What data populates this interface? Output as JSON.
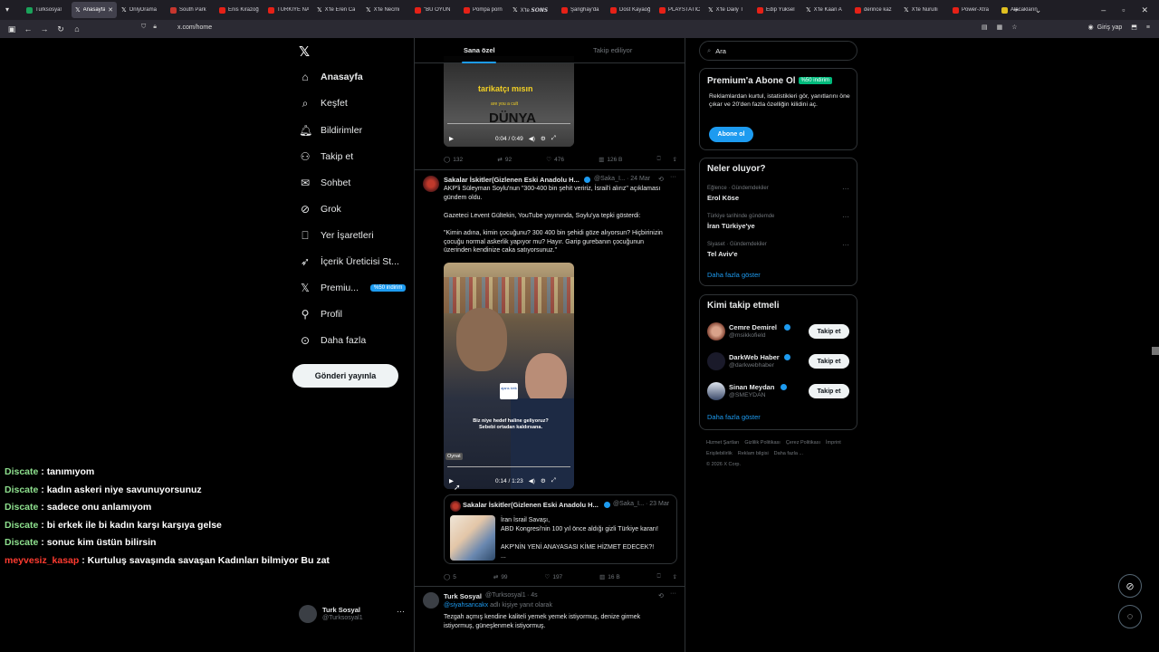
{
  "browser": {
    "tabs": [
      {
        "label": "Turksosyal",
        "fav": "g"
      },
      {
        "label": "Anasayfa",
        "fav": "x",
        "active": true
      },
      {
        "label": "OnlyDrama",
        "fav": "x"
      },
      {
        "label": "South Park",
        "fav": "sp"
      },
      {
        "label": "Enis Kirazoğ",
        "fav": "yt"
      },
      {
        "label": "TÜRKİYE NA",
        "fav": "yt"
      },
      {
        "label": "X'te Eren Ca",
        "fav": "x"
      },
      {
        "label": "X'te Necmi",
        "fav": "x"
      },
      {
        "label": "\"BU OYUN",
        "fav": "yt"
      },
      {
        "label": "Pompa porn",
        "fav": "yt"
      },
      {
        "label": "X'te 𝙎𝙊𝙉𝙎",
        "fav": "x"
      },
      {
        "label": "Şanghay'da",
        "fav": "yt"
      },
      {
        "label": "Dost Kayaoğ",
        "fav": "yt"
      },
      {
        "label": "PLAYSTATIC",
        "fav": "yt"
      },
      {
        "label": "X'te Daily T",
        "fav": "x"
      },
      {
        "label": "Edip Yüksel",
        "fav": "yt"
      },
      {
        "label": "X'te Kaan A",
        "fav": "x"
      },
      {
        "label": "derince kaz",
        "fav": "yt"
      },
      {
        "label": "X'te Nurullı",
        "fav": "x"
      },
      {
        "label": "Power-Xtra",
        "fav": "yt"
      },
      {
        "label": "Alacakların",
        "fav": "yel"
      }
    ],
    "url": "x.com/home",
    "signin_label": "Giriş yap"
  },
  "sidebar": {
    "items": [
      {
        "label": "Anasayfa",
        "icon": "home-icon"
      },
      {
        "label": "Keşfet",
        "icon": "search-icon"
      },
      {
        "label": "Bildirimler",
        "icon": "bell-icon"
      },
      {
        "label": "Takip et",
        "icon": "add-user-icon"
      },
      {
        "label": "Sohbet",
        "icon": "mail-icon"
      },
      {
        "label": "Grok",
        "icon": "grok-icon"
      },
      {
        "label": "Yer İşaretleri",
        "icon": "bookmark-icon"
      },
      {
        "label": "İçerik Üreticisi St...",
        "icon": "rocket-icon"
      },
      {
        "label": "Premiu...",
        "icon": "x-icon"
      },
      {
        "label": "Profil",
        "icon": "person-icon"
      },
      {
        "label": "Daha fazla",
        "icon": "more-circle-icon"
      }
    ],
    "premium_badge": "%50 indirim",
    "post_button": "Gönderi yayınla",
    "account": {
      "name": "Turk Sosyal",
      "handle": "@Turksosyal1"
    }
  },
  "feed": {
    "tabs": [
      "Sana özel",
      "Takip ediliyor"
    ],
    "post1": {
      "video_caption1": "tarikatçı mısın",
      "video_caption2": "are you a cult",
      "video_caption3": "DÜNYA",
      "time": "0:04 / 0:49",
      "replies": "132",
      "reposts": "92",
      "likes": "476",
      "views": "126 B"
    },
    "post2": {
      "name": "Sakalar İskitler(Gizlenen Eski Anadolu H...",
      "handle": "@Saka_I...",
      "date": "· 24 Mar",
      "text1": "AKP'li Süleyman Soylu'nun \"300-400 bin şehit veririz, İsrail'i alırız\" açıklaması gündem oldu.",
      "text2": "Gazeteci Levent Gültekin, YouTube yayınında, Soylu'ya tepki gösterdi:",
      "text3": "\"Kimin adına, kimin çocuğunu? 300 400 bin şehidi göze alıyorsun? Hiçbirinizin çocuğu normal askerlik yapıyor mu? Hayır. Garip gurebanın çocuğunun üzerinden kendinize caka satıyorsunuz.\"",
      "video_subtitle": "Biz niye hedef haline geliyoruz? Sebebi ortadan kaldırsana.",
      "video_logo": "ajans kirik",
      "play_tooltip": "Oynat",
      "time": "0:14 / 1:23",
      "quote": {
        "name": "Sakalar İskitler(Gizlenen Eski Anadolu H...",
        "handle": "@Saka_I...",
        "date": "· 23 Mar",
        "line1": "İran İsrail Savaşı,",
        "line2": "ABD Kongresi'nin 100 yıl önce aldığı gizli Türkiye kararı!",
        "line3": "AKP'NİN YENİ ANAYASASI KİME HİZMET EDECEK?!",
        "line4": "..."
      },
      "replies": "5",
      "reposts": "99",
      "likes": "197",
      "views": "16 B"
    },
    "post3": {
      "name": "Turk Sosyal",
      "handle": "@Turksosyal1",
      "date": "· 4s",
      "reply_to": "@siyahsancakx",
      "reply_suffix": " adlı kişiye yanıt olarak",
      "text": "Tezgah açmış kendine kaliteli yemek yemek istiyormuş, denize girmek istiyormuş, güneşlenmek istiyormuş."
    }
  },
  "right": {
    "search_placeholder": "Ara",
    "premium": {
      "title": "Premium'a Abone Ol",
      "badge": "%50 indirim",
      "text": "Reklamlardan kurtul, istatistikleri gör, yanıtlarını öne çıkar ve 20'den fazla özelliğin kilidini aç.",
      "button": "Abone ol"
    },
    "trends": {
      "title": "Neler oluyor?",
      "items": [
        {
          "cat": "Eğlence · Gündemdekiler",
          "name": "Erol Köse"
        },
        {
          "cat": "Türkiye tarihinde gündemde",
          "name": "İran Türkiye'ye"
        },
        {
          "cat": "Siyaset · Gündemdekiler",
          "name": "Tel Aviv'e"
        }
      ],
      "show_more": "Daha fazla göster"
    },
    "who_to_follow": {
      "title": "Kimi takip etmeli",
      "items": [
        {
          "name": "Cemre Demirel",
          "handle": "@msikkofield",
          "button": "Takip et"
        },
        {
          "name": "DarkWeb Haber",
          "handle": "@darkwebhaber",
          "button": "Takip et"
        },
        {
          "name": "Sinan Meydan",
          "handle": "@SMEYDAN",
          "button": "Takip et"
        }
      ],
      "show_more": "Daha fazla göster"
    },
    "footer": [
      "Hizmet Şartları",
      "Gizlilik Politikası",
      "Çerez Politikası",
      "İmprint",
      "Erişilebilirlik",
      "Reklam bilgisi",
      "Daha fazla ...",
      "© 2026 X Corp."
    ]
  },
  "chat": [
    {
      "user": "Discate",
      "msg": " : tanımıyom"
    },
    {
      "user": "Discate",
      "msg": " : kadın askeri niye savunuyorsunuz"
    },
    {
      "user": "Discate",
      "msg": " : sadece onu anlamıyom"
    },
    {
      "user": "Discate",
      "msg": " : bi erkek ile bi kadın karşı karşıya gelse"
    },
    {
      "user": "Discate",
      "msg": " : sonuc kim üstün bilirsin"
    },
    {
      "user": "meyvesiz_kasap",
      "msg": " : Kurtuluş savaşında savaşan Kadınları bilmiyor Bu zat",
      "red": true
    }
  ]
}
